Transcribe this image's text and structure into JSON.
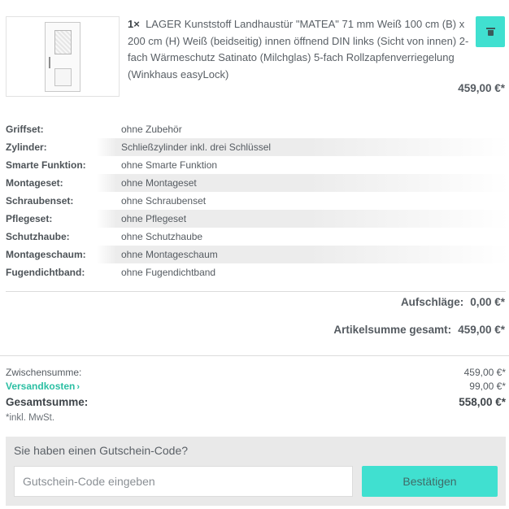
{
  "product": {
    "quantity": "1×",
    "title": "LAGER Kunststoff Landhaustür \"MATEA\" 71 mm Weiß 100 cm (B) x 200 cm (H) Weiß (beidseitig) innen öffnend DIN links (Sicht von innen) 2-fach Wärmeschutz Satinato (Milchglas) 5-fach Rollzapfenverriegelung (Winkhaus easyLock)",
    "price": "459,00 €*",
    "delete_icon": "trash-icon"
  },
  "options": [
    {
      "label": "Griffset:",
      "value": "ohne Zubehör"
    },
    {
      "label": "Zylinder:",
      "value": "Schließzylinder inkl. drei Schlüssel"
    },
    {
      "label": "Smarte Funktion:",
      "value": "ohne Smarte Funktion"
    },
    {
      "label": "Montageset:",
      "value": "ohne Montageset"
    },
    {
      "label": "Schraubenset:",
      "value": "ohne Schraubenset"
    },
    {
      "label": "Pflegeset:",
      "value": "ohne Pflegeset"
    },
    {
      "label": "Schutzhaube:",
      "value": "ohne Schutzhaube"
    },
    {
      "label": "Montageschaum:",
      "value": "ohne Montageschaum"
    },
    {
      "label": "Fugendichtband:",
      "value": "ohne Fugendichtband"
    }
  ],
  "surcharges": {
    "label": "Aufschläge:",
    "value": "0,00 €*"
  },
  "item_total": {
    "label": "Artikelsumme gesamt:",
    "value": "459,00 €*"
  },
  "totals": {
    "subtotal_label": "Zwischensumme:",
    "subtotal_value": "459,00 €*",
    "shipping_label": "Versandkosten",
    "shipping_value": "99,00 €*",
    "grand_label": "Gesamtsumme:",
    "grand_value": "558,00 €*",
    "vat_note": "*inkl. MwSt."
  },
  "coupon": {
    "heading": "Sie haben einen Gutschein-Code?",
    "placeholder": "Gutschein-Code eingeben",
    "button_label": "Bestätigen"
  },
  "colors": {
    "accent": "#40e0d0",
    "link": "#2bbfa3",
    "text": "#555b61"
  }
}
